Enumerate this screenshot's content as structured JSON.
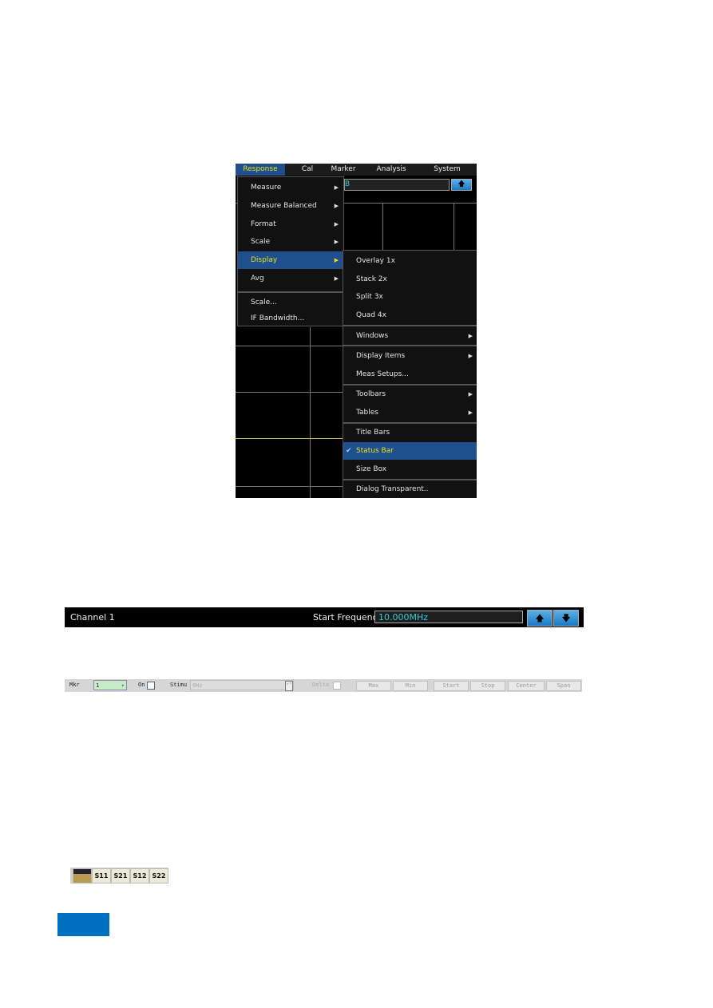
{
  "menu_screenshot": {
    "menubar": [
      "Response",
      "Cal",
      "Marker",
      "Analysis",
      "System"
    ],
    "input_fragment": "B",
    "response_menu": {
      "items": [
        {
          "label": "Measure",
          "submenu": true
        },
        {
          "label": "Measure Balanced",
          "submenu": true
        },
        {
          "label": "Format",
          "submenu": true
        },
        {
          "label": "Scale",
          "submenu": true
        },
        {
          "label": "Display",
          "submenu": true,
          "highlighted": true
        },
        {
          "label": "Avg",
          "submenu": true
        },
        {
          "label": "Scale..."
        },
        {
          "label": "IF Bandwidth..."
        }
      ]
    },
    "display_submenu": {
      "items": [
        {
          "label": "Overlay 1x"
        },
        {
          "label": "Stack 2x"
        },
        {
          "label": "Split 3x"
        },
        {
          "label": "Quad 4x"
        },
        {
          "label": "Windows",
          "submenu": true
        },
        {
          "label": "Display Items",
          "submenu": true
        },
        {
          "label": "Meas Setups..."
        },
        {
          "label": "Toolbars",
          "submenu": true
        },
        {
          "label": "Tables",
          "submenu": true
        },
        {
          "label": "Title Bars"
        },
        {
          "label": "Status Bar",
          "checked": true,
          "highlighted": true
        },
        {
          "label": "Size Box"
        },
        {
          "label": "Dialog Transparent.."
        }
      ]
    },
    "colors": {
      "highlight": "#1f4f8c",
      "highlight_text": "#e8e020",
      "trace": "#c8c040"
    }
  },
  "channel_bar": {
    "title": "Channel 1",
    "label": "Start Frequency",
    "value": "10.000MHz",
    "up_icon": "arrow-up",
    "down_icon": "arrow-down"
  },
  "marker_toolbar": {
    "mkr_label": "Mkr",
    "mkr_value": "1",
    "on_label": "On",
    "stim_label": "Stimu",
    "stim_value": "0Hz",
    "delta_label": "Delta",
    "buttons": [
      "Max",
      "Min",
      "Start",
      "Stop",
      "Center",
      "Span"
    ]
  },
  "sparam_toolbar": {
    "buttons": [
      "S11",
      "S21",
      "S12",
      "S22"
    ]
  },
  "page_tab_color": "#0070c0"
}
